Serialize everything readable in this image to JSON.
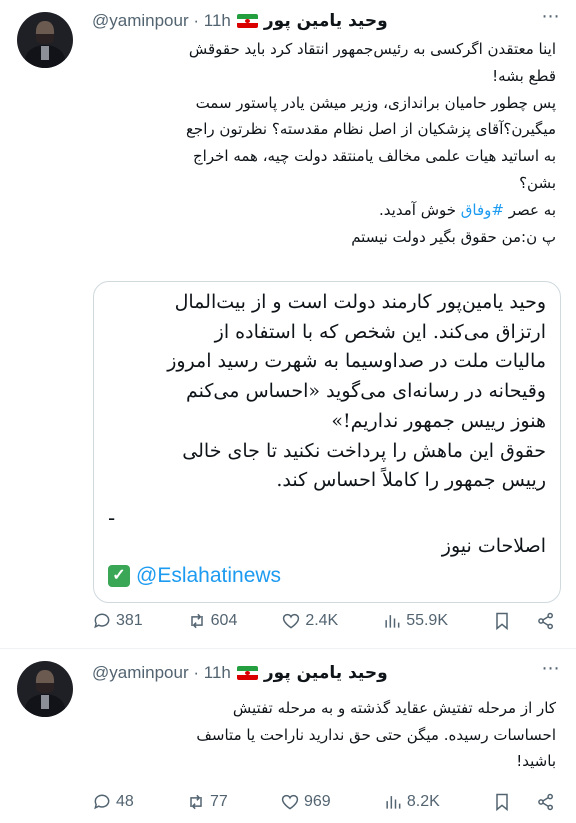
{
  "tweets": [
    {
      "author_name": "وحید یامین پور",
      "handle": "@yaminpour",
      "time": "11h",
      "lines": [
        "اینا معتقدن اگرکسی به رئیس‌جمهور انتقاد کرد باید حقوقش",
        "قطع بشه!",
        "پس چطور حامیان براندازی، وزیر میشن یادر پاستور سمت",
        "میگیرن؟آقای پزشکیان از اصل نظام مقدسته؟ نظرتون راجع",
        "به اساتید هیات علمی مخالف یامنتقد دولت چیه، همه اخراج",
        "بشن؟"
      ],
      "line_hashtag_prefix": "به عصر ",
      "hashtag": "#وفاق",
      "line_hashtag_suffix": " خوش آمدید.",
      "last_line": "پ ن:من حقوق بگیر دولت نیستم",
      "quote": {
        "lines": [
          "وحید یامین‌پور کارمند دولت است و از بیت‌المال",
          "ارتزاق می‌کند. این شخص که با استفاده از",
          "مالیات ملت در صداوسیما به شهرت رسید امروز",
          "وقیحانه در رسانه‌ای می‌گوید «احساس می‌کنم",
          "هنوز رییس جمهور نداریم!»",
          "حقوق این ماهش را پرداخت نکنید تا جای خالی",
          "رییس جمهور را کاملاً احساس کند."
        ],
        "dash": "-",
        "source": "اصلاحات نیوز",
        "source_handle": "@Eslahatinews"
      },
      "stats": {
        "replies": "381",
        "retweets": "604",
        "likes": "2.4K",
        "views": "55.9K"
      }
    },
    {
      "author_name": "وحید یامین پور",
      "handle": "@yaminpour",
      "time": "11h",
      "lines": [
        "کار از مرحله تفتیش عقاید گذشته و به مرحله تفتیش",
        "احساسات رسیده. میگن حتی حق ندارید ناراحت یا متاسف",
        "باشید!"
      ],
      "stats": {
        "replies": "48",
        "retweets": "77",
        "likes": "969",
        "views": "8.2K"
      }
    }
  ],
  "separator": "·",
  "more_icon": "more-dots-icon",
  "colors": {
    "link": "#1d9bf0",
    "muted": "#536471",
    "border": "#cfd9de",
    "verified_check": "#3aa757"
  }
}
